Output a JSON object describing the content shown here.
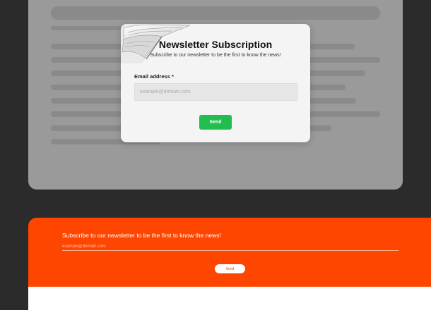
{
  "modal": {
    "title": "Newsletter Subscription",
    "subtitle": "Subscribe to our newsletter to be the first to know the news!",
    "email_label": "Email address *",
    "email_placeholder": "example@domain.com",
    "send_label": "Send",
    "send_color": "#21bd4e",
    "illustration": "open-book-icon"
  },
  "embed": {
    "text": "Subscribe to our newsletter to be the first to know the news!",
    "email_placeholder": "example@domain.com",
    "send_label": "Send",
    "background_color": "#ff4600"
  },
  "colors": {
    "page_background": "#2b2b2b",
    "placeholder_card": "#9a9a9a"
  }
}
